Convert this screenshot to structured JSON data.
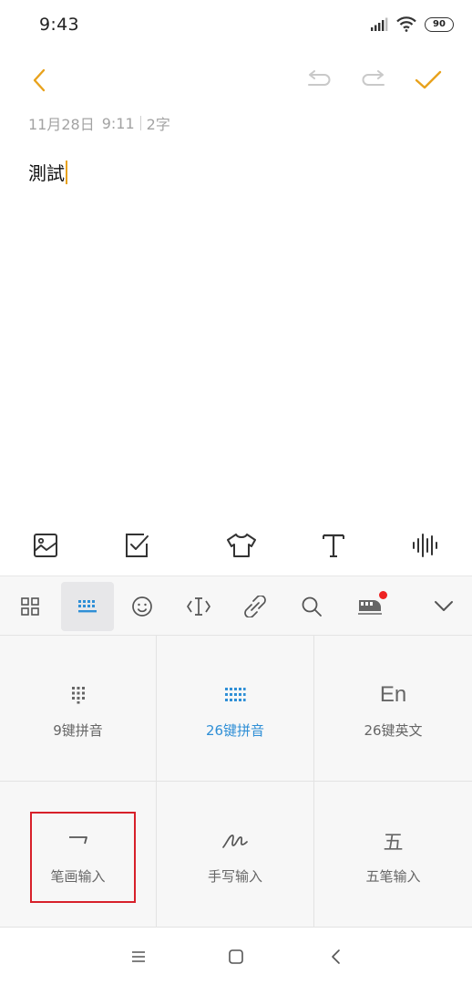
{
  "status_bar": {
    "time": "9:43",
    "battery_level": "90",
    "icons": [
      "signal-icon",
      "wifi-icon",
      "battery-icon"
    ]
  },
  "toolbar": {
    "back_icon": "chevron-left-icon",
    "undo_icon": "undo-icon",
    "redo_icon": "redo-icon",
    "confirm_icon": "check-icon",
    "accent_color": "#e8a21c"
  },
  "note": {
    "date": "11月28日",
    "time": "9:11",
    "char_count": "2字",
    "content": "測試"
  },
  "format_bar": {
    "items": [
      "image-icon",
      "checkbox-icon",
      "theme-shirt-icon",
      "text-format-icon",
      "voice-wave-icon"
    ]
  },
  "ime_toolbar": {
    "items": [
      "grid-apps-icon",
      "keyboard-icon",
      "emoji-icon",
      "cursor-move-icon",
      "clip-link-icon",
      "search-icon",
      "train-icon",
      "chevron-down-icon"
    ],
    "active": "keyboard-icon",
    "notification_dot_color": "#ee2222"
  },
  "keyboard_modes": {
    "items": [
      {
        "label": "9键拼音",
        "icon": "nine-key-icon"
      },
      {
        "label": "26键拼音",
        "icon": "full-keyboard-icon",
        "selected": true
      },
      {
        "label": "26键英文",
        "icon_text": "En"
      },
      {
        "label": "笔画输入",
        "icon": "stroke-icon",
        "highlighted": true
      },
      {
        "label": "手写输入",
        "icon": "handwriting-icon"
      },
      {
        "label": "五笔输入",
        "icon_text": "五"
      }
    ],
    "selected_color": "#2f8fd6",
    "highlight_color": "#d7202a"
  },
  "nav_bar": {
    "items": [
      "menu-icon",
      "home-icon",
      "back-icon"
    ]
  }
}
